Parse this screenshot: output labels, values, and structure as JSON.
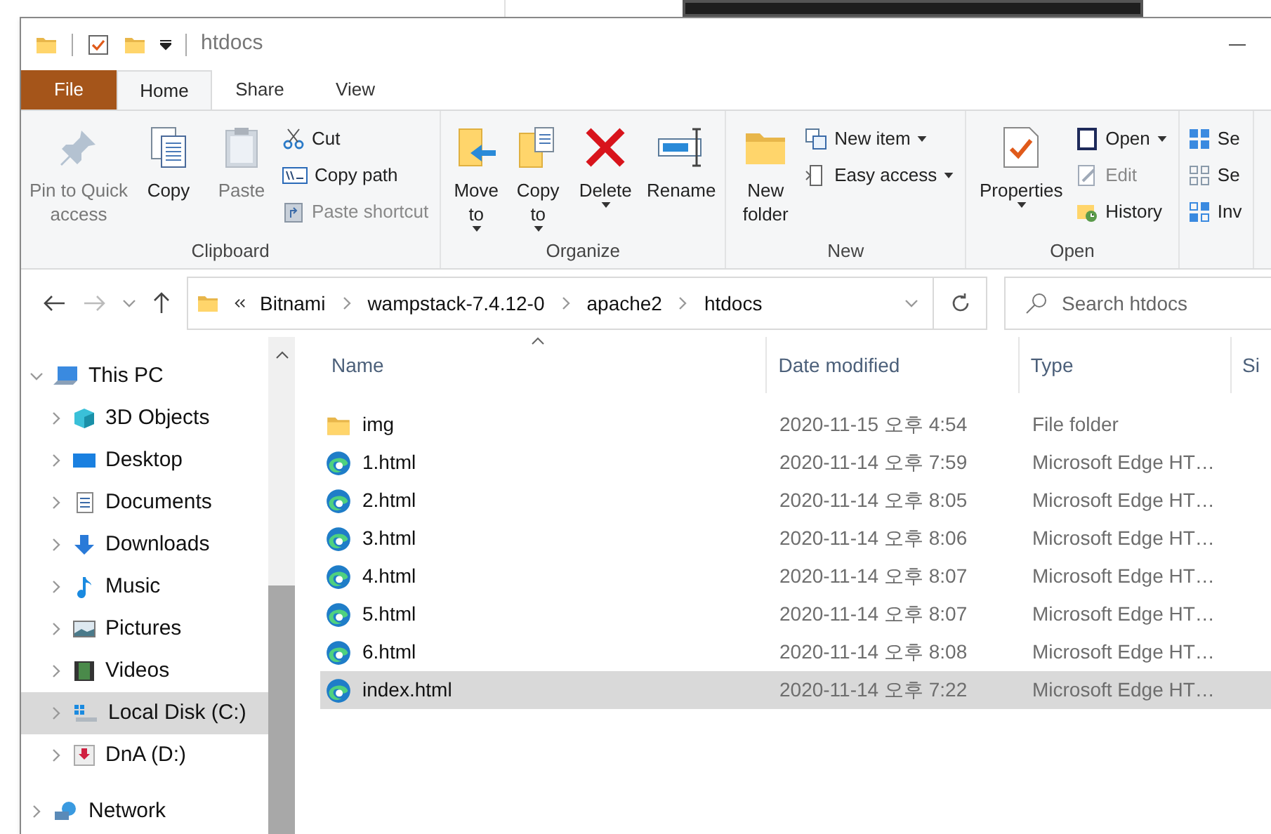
{
  "title_bar": {
    "title": "htdocs"
  },
  "ribbon_tabs": [
    {
      "label": "File",
      "kind": "file",
      "selected": false
    },
    {
      "label": "Home",
      "kind": "tab",
      "selected": true
    },
    {
      "label": "Share",
      "kind": "tab",
      "selected": false
    },
    {
      "label": "View",
      "kind": "tab",
      "selected": false
    }
  ],
  "ribbon_groups": [
    {
      "label": "Clipboard",
      "items": [
        {
          "kind": "large",
          "label": "Pin to Quick access",
          "disabled": true
        },
        {
          "kind": "large",
          "label": "Copy",
          "disabled": false
        },
        {
          "kind": "large",
          "label": "Paste",
          "disabled": true
        },
        {
          "kind": "small",
          "label": "Cut",
          "disabled": false
        },
        {
          "kind": "small",
          "label": "Copy path",
          "disabled": false
        },
        {
          "kind": "small",
          "label": "Paste shortcut",
          "disabled": true
        }
      ]
    },
    {
      "label": "Organize",
      "items": [
        {
          "kind": "large",
          "label": "Move to",
          "dropdown": true,
          "disabled": false
        },
        {
          "kind": "large",
          "label": "Copy to",
          "dropdown": true,
          "disabled": false
        },
        {
          "kind": "large",
          "label": "Delete",
          "dropdown": true,
          "disabled": false
        },
        {
          "kind": "large",
          "label": "Rename",
          "disabled": false
        }
      ]
    },
    {
      "label": "New",
      "items": [
        {
          "kind": "large",
          "label": "New folder",
          "disabled": false
        },
        {
          "kind": "small",
          "label": "New item",
          "dropdown": true,
          "disabled": false
        },
        {
          "kind": "small",
          "label": "Easy access",
          "dropdown": true,
          "disabled": false
        }
      ]
    },
    {
      "label": "Open",
      "items": [
        {
          "kind": "large",
          "label": "Properties",
          "dropdown": true,
          "disabled": false
        },
        {
          "kind": "small",
          "label": "Open",
          "dropdown": true,
          "disabled": false
        },
        {
          "kind": "small",
          "label": "Edit",
          "disabled": true
        },
        {
          "kind": "small",
          "label": "History",
          "disabled": false
        }
      ]
    },
    {
      "items": [
        {
          "kind": "small",
          "label": "Se",
          "disabled": false
        },
        {
          "kind": "small",
          "label": "Se",
          "disabled": false
        },
        {
          "kind": "small",
          "label": "Inv",
          "disabled": false
        }
      ]
    }
  ],
  "address_bar": {
    "back_disabled": false,
    "forward_disabled": true,
    "path": [
      "Bitnami",
      "wampstack-7.4.12-0",
      "apache2",
      "htdocs"
    ]
  },
  "search": {
    "placeholder": "Search htdocs"
  },
  "navigation": [
    {
      "label": "This PC",
      "expanded": true,
      "selected": false,
      "children": [
        {
          "label": "3D Objects",
          "expanded": false,
          "selected": false
        },
        {
          "label": "Desktop",
          "expanded": false,
          "selected": false
        },
        {
          "label": "Documents",
          "expanded": false,
          "selected": false
        },
        {
          "label": "Downloads",
          "expanded": false,
          "selected": false
        },
        {
          "label": "Music",
          "expanded": false,
          "selected": false
        },
        {
          "label": "Pictures",
          "expanded": false,
          "selected": false
        },
        {
          "label": "Videos",
          "expanded": false,
          "selected": false
        },
        {
          "label": "Local Disk (C:)",
          "expanded": false,
          "selected": true
        },
        {
          "label": "DnA (D:)",
          "expanded": false,
          "selected": false
        }
      ]
    },
    {
      "label": "Network",
      "expanded": false,
      "selected": false
    }
  ],
  "columns": [
    "Name",
    "Date modified",
    "Type",
    "Si"
  ],
  "files": [
    {
      "kind": "folder",
      "name": "img",
      "date": "2020-11-15 오후 4:54",
      "type": "File folder",
      "selected": false
    },
    {
      "kind": "file",
      "name": "1.html",
      "date": "2020-11-14 오후 7:59",
      "type": "Microsoft Edge HT…",
      "selected": false
    },
    {
      "kind": "file",
      "name": "2.html",
      "date": "2020-11-14 오후 8:05",
      "type": "Microsoft Edge HT…",
      "selected": false
    },
    {
      "kind": "file",
      "name": "3.html",
      "date": "2020-11-14 오후 8:06",
      "type": "Microsoft Edge HT…",
      "selected": false
    },
    {
      "kind": "file",
      "name": "4.html",
      "date": "2020-11-14 오후 8:07",
      "type": "Microsoft Edge HT…",
      "selected": false
    },
    {
      "kind": "file",
      "name": "5.html",
      "date": "2020-11-14 오후 8:07",
      "type": "Microsoft Edge HT…",
      "selected": false
    },
    {
      "kind": "file",
      "name": "6.html",
      "date": "2020-11-14 오후 8:08",
      "type": "Microsoft Edge HT…",
      "selected": false
    },
    {
      "kind": "file",
      "name": "index.html",
      "date": "2020-11-14 오후 7:22",
      "type": "Microsoft Edge HT…",
      "selected": true
    }
  ]
}
